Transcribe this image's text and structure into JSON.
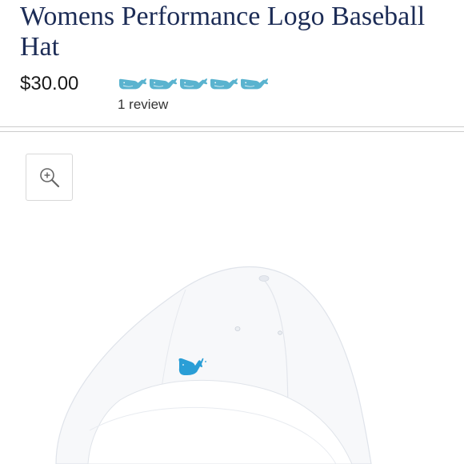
{
  "product": {
    "title": "Womens Performance Logo Baseball Hat",
    "price": "$30.00",
    "rating": 5,
    "rating_max": 5,
    "review_text": "1 review"
  },
  "icons": {
    "rating_icon": "whale-icon",
    "zoom_icon": "zoom-in-icon",
    "logo": "whale-logo-icon"
  },
  "colors": {
    "title": "#1c2c56",
    "rating_whale": "#5ab3cf",
    "hat_logo": "#2a9ed6"
  }
}
